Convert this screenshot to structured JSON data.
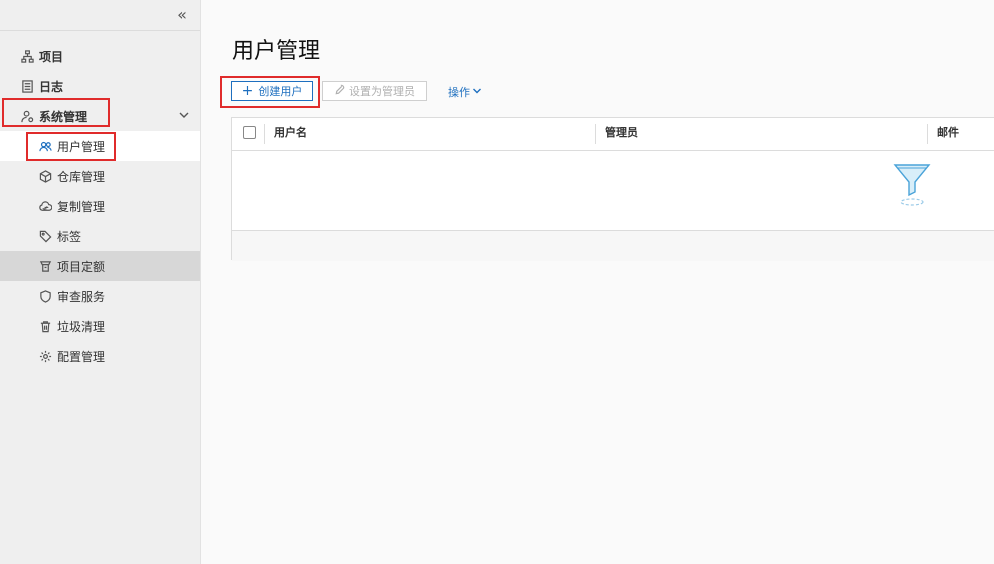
{
  "sidebar": {
    "collapse_glyph": "«",
    "items": [
      {
        "label": "项目",
        "icon": "sitemap-icon"
      },
      {
        "label": "日志",
        "icon": "log-icon"
      },
      {
        "label": "系统管理",
        "icon": "user-gear-icon"
      },
      {
        "label": "用户管理",
        "icon": "users-icon"
      },
      {
        "label": "仓库管理",
        "icon": "cube-icon"
      },
      {
        "label": "复制管理",
        "icon": "cloud-sync-icon"
      },
      {
        "label": "标签",
        "icon": "tag-icon"
      },
      {
        "label": "项目定额",
        "icon": "quota-icon"
      },
      {
        "label": "审查服务",
        "icon": "shield-icon"
      },
      {
        "label": "垃圾清理",
        "icon": "trash-icon"
      },
      {
        "label": "配置管理",
        "icon": "gear-icon"
      }
    ]
  },
  "main": {
    "title": "用户管理",
    "toolbar": {
      "create_label": "创建用户",
      "set_admin_label": "设置为管理员",
      "actions_label": "操作"
    },
    "table": {
      "columns": [
        "用户名",
        "管理员",
        "邮件"
      ]
    }
  },
  "colors": {
    "accent": "#1e6fbf",
    "highlight_box": "#e02b2b",
    "sidebar_bg": "#efefef"
  }
}
